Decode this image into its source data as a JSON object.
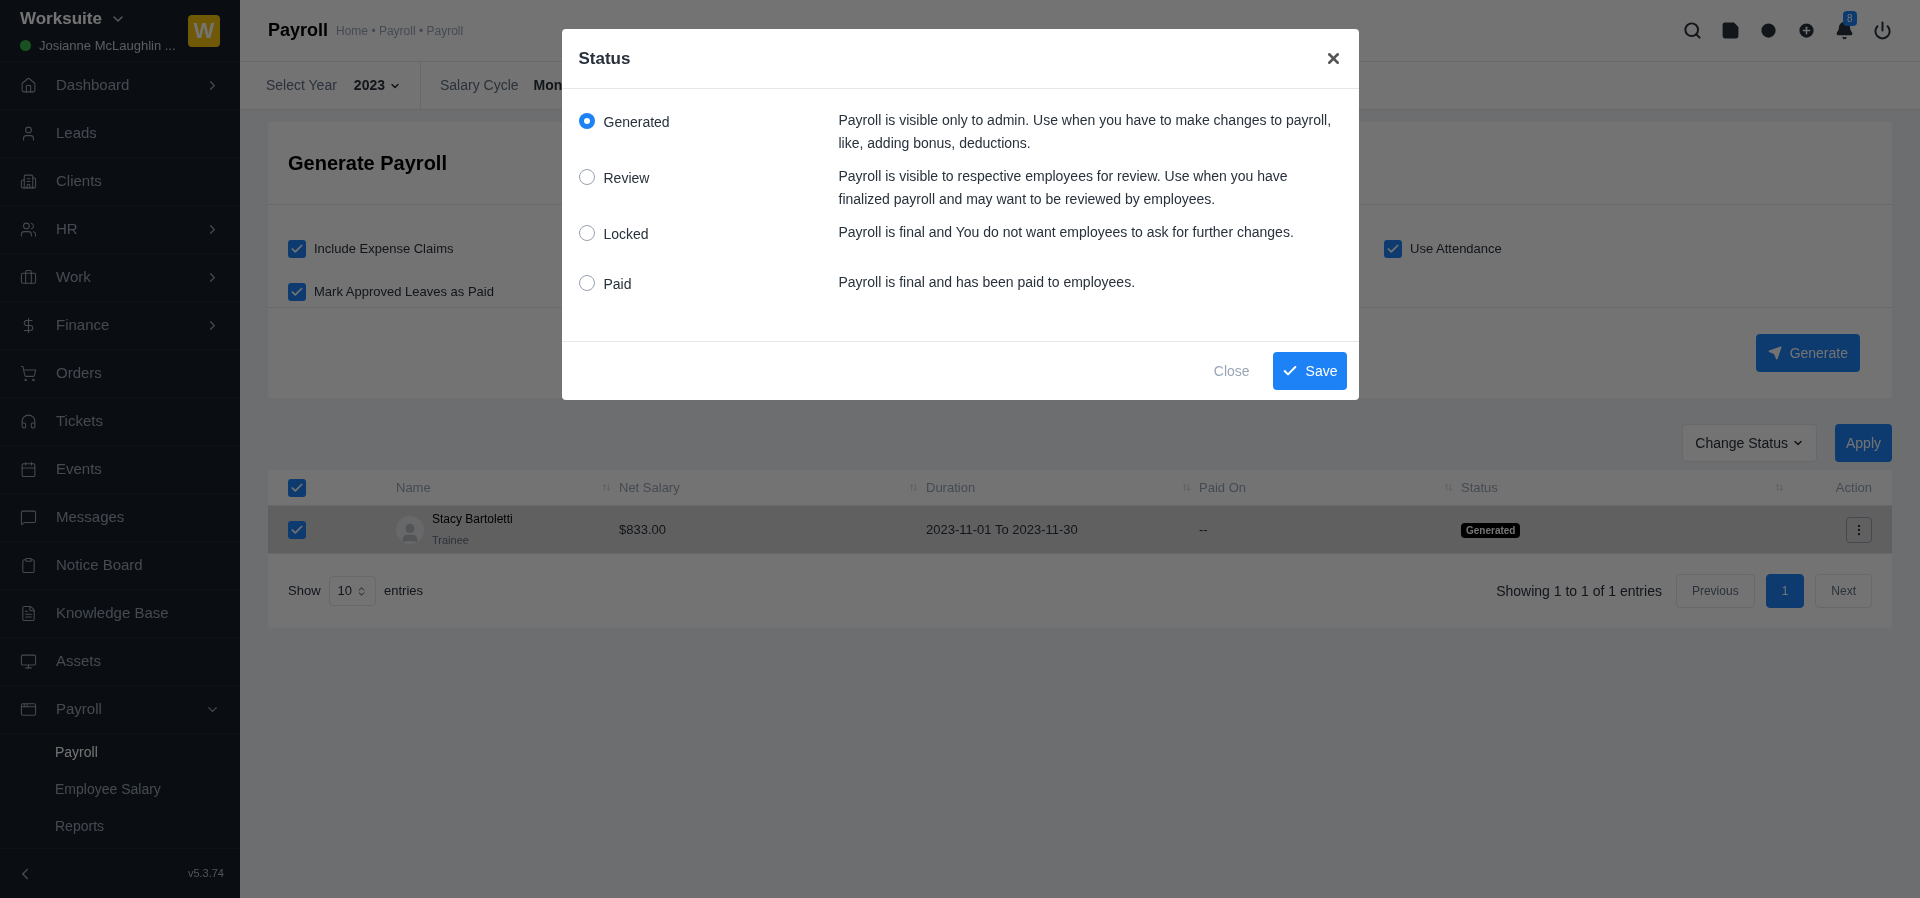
{
  "sidebar": {
    "brand": "Worksuite",
    "user": "Josianne McLaughlin ...",
    "logo": "W",
    "items": [
      {
        "label": "Dashboard",
        "kind": "group",
        "expanded": false
      },
      {
        "label": "Leads",
        "kind": "link"
      },
      {
        "label": "Clients",
        "kind": "link"
      },
      {
        "label": "HR",
        "kind": "group",
        "expanded": false
      },
      {
        "label": "Work",
        "kind": "group",
        "expanded": false
      },
      {
        "label": "Finance",
        "kind": "group",
        "expanded": false
      },
      {
        "label": "Orders",
        "kind": "link"
      },
      {
        "label": "Tickets",
        "kind": "link"
      },
      {
        "label": "Events",
        "kind": "link"
      },
      {
        "label": "Messages",
        "kind": "link"
      },
      {
        "label": "Notice Board",
        "kind": "link"
      },
      {
        "label": "Knowledge Base",
        "kind": "link"
      },
      {
        "label": "Assets",
        "kind": "link"
      },
      {
        "label": "Payroll",
        "kind": "group",
        "expanded": true,
        "children": [
          {
            "label": "Payroll",
            "selected": true
          },
          {
            "label": "Employee Salary",
            "selected": false
          },
          {
            "label": "Reports",
            "selected": false
          }
        ]
      }
    ],
    "version": "v5.3.74"
  },
  "header": {
    "title": "Payroll",
    "breadcrumb": "Home • Payroll • Payroll",
    "notification_count": "8"
  },
  "filters": {
    "year_label": "Select Year",
    "year": "2023",
    "cycle_label": "Salary Cycle",
    "cycle": "Mon"
  },
  "generate_card": {
    "title": "Generate Payroll",
    "options": [
      {
        "label": "Include Expense Claims",
        "checked": true
      },
      {
        "label": "Mark Approved Leaves as Paid",
        "checked": true
      },
      {
        "label": "Use Attendance",
        "checked": true
      }
    ],
    "button": "Generate"
  },
  "bulk_actions": {
    "dropdown": "Change Status",
    "button": "Apply"
  },
  "table": {
    "select_all": true,
    "columns": [
      "Name",
      "Net Salary",
      "Duration",
      "Paid On",
      "Status",
      "Action"
    ],
    "rows": [
      {
        "checked": true,
        "name": "Stacy Bartoletti",
        "designation": "Trainee",
        "net_salary": "$833.00",
        "duration": "2023-11-01 To 2023-11-30",
        "paid_on": "--",
        "status": "Generated"
      }
    ],
    "show_label": "Show",
    "page_size": "10",
    "entries_label": "entries",
    "summary": "Showing 1 to 1 of 1 entries",
    "pagination": [
      {
        "label": "Previous",
        "selected": false
      },
      {
        "label": "1",
        "selected": true
      },
      {
        "label": "Next",
        "selected": false
      }
    ]
  },
  "modal": {
    "title": "Status",
    "options": [
      {
        "label": "Generated",
        "selected": true,
        "description": "Payroll is visible only to admin. Use when you have to make changes to payroll, like, adding bonus, deductions."
      },
      {
        "label": "Review",
        "selected": false,
        "description": "Payroll is visible to respective employees for review. Use when you have finalized payroll and may want to be reviewed by employees."
      },
      {
        "label": "Locked",
        "selected": false,
        "description": "Payroll is final and You do not want employees to ask for further changes."
      },
      {
        "label": "Paid",
        "selected": false,
        "description": "Payroll is final and has been paid to employees."
      }
    ],
    "close": "Close",
    "save": "Save"
  }
}
